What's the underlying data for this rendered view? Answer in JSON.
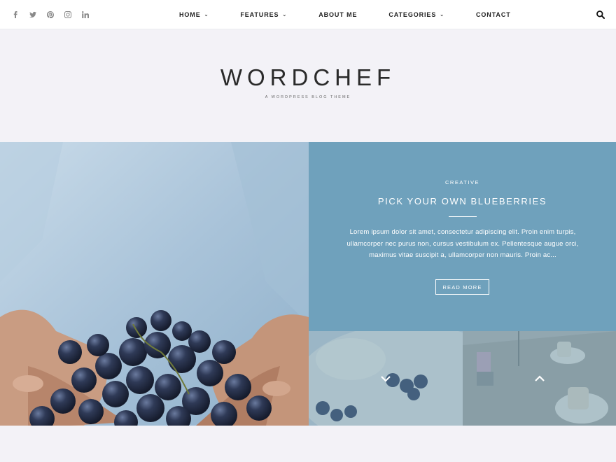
{
  "social": {
    "icons": [
      "facebook-icon",
      "twitter-icon",
      "pinterest-icon",
      "instagram-icon",
      "linkedin-icon"
    ]
  },
  "nav": {
    "items": [
      {
        "label": "HOME",
        "dropdown": true
      },
      {
        "label": "FEATURES",
        "dropdown": true
      },
      {
        "label": "ABOUT ME",
        "dropdown": false
      },
      {
        "label": "CATEGORIES",
        "dropdown": true
      },
      {
        "label": "CONTACT",
        "dropdown": false
      }
    ],
    "search_icon": "search-icon"
  },
  "brand": {
    "title": "WORDCHEF",
    "tagline": "A WORDPRESS BLOG THEME"
  },
  "featured": {
    "category": "CREATIVE",
    "title": "PICK YOUR OWN BLUEBERRIES",
    "excerpt": "Lorem ipsum dolor sit amet, consectetur adipiscing elit. Proin enim turpis, ullamcorper nec purus non, cursus vestibulum ex. Pellentesque augue orci, maximus vitae suscipit a, ullamcorper non mauris. Proin ac...",
    "read_more": "READ MORE"
  },
  "thumbs": {
    "prev_icon": "chevron-down-icon",
    "next_icon": "chevron-up-icon"
  },
  "colors": {
    "panel": "#6fa1bc",
    "topbar": "#ffffff",
    "background": "#f3f2f7"
  }
}
